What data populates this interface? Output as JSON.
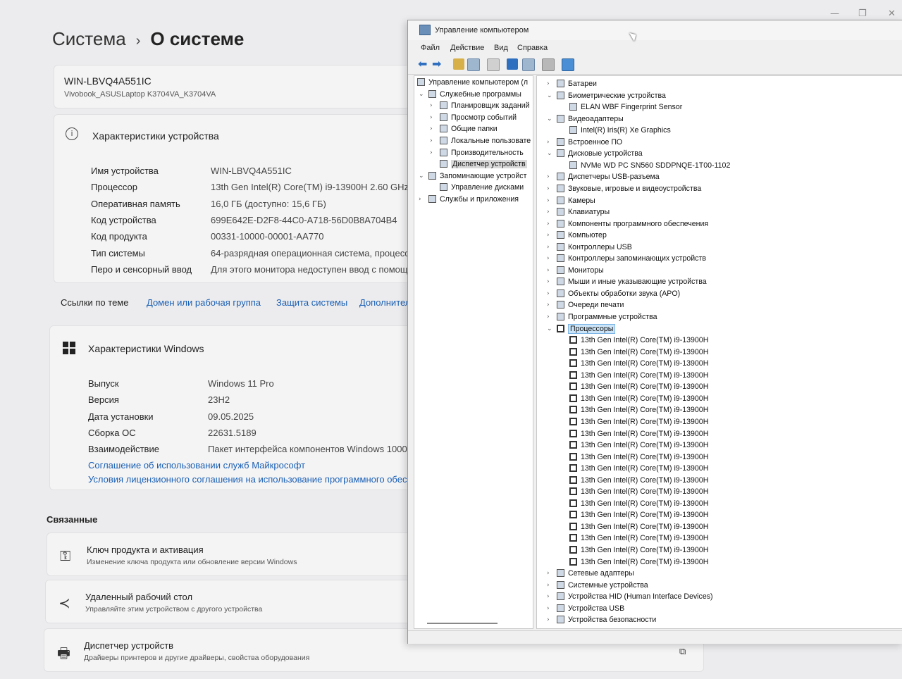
{
  "settings": {
    "breadcrumb": {
      "root": "Система",
      "separator": "›",
      "current": "О системе"
    },
    "device_card": {
      "name": "WIN-LBVQ4A551IC",
      "model": "Vivobook_ASUSLaptop K3704VA_K3704VA"
    },
    "device_specs": {
      "heading": "Характеристики устройства",
      "rows": [
        {
          "key": "Имя устройства",
          "value": "WIN-LBVQ4A551IC"
        },
        {
          "key": "Процессор",
          "value": "13th Gen Intel(R) Core(TM) i9-13900H   2.60 GHz"
        },
        {
          "key": "Оперативная память",
          "value": "16,0 ГБ (доступно: 15,6 ГБ)"
        },
        {
          "key": "Код устройства",
          "value": "699E642E-D2F8-44C0-A718-56D0B8A704B4"
        },
        {
          "key": "Код продукта",
          "value": "00331-10000-00001-AA770"
        },
        {
          "key": "Тип системы",
          "value": "64-разрядная операционная система, процессо"
        },
        {
          "key": "Перо и сенсорный ввод",
          "value": "Для этого монитора недоступен ввод с помощь"
        }
      ]
    },
    "related_links": {
      "label": "Ссылки по теме",
      "links": [
        "Домен или рабочая группа",
        "Защита системы",
        "Дополнител"
      ]
    },
    "windows_specs": {
      "heading": "Характеристики Windows",
      "rows": [
        {
          "key": "Выпуск",
          "value": "Windows 11 Pro"
        },
        {
          "key": "Версия",
          "value": "23H2"
        },
        {
          "key": "Дата установки",
          "value": "09.05.2025"
        },
        {
          "key": "Сборка ОС",
          "value": "22631.5189"
        },
        {
          "key": "Взаимодействие",
          "value": "Пакет интерфейса компонентов Windows 1000.2"
        }
      ],
      "links": [
        "Соглашение об использовании служб Майкрософт",
        "Условия лицензионного соглашения на использование программного обес"
      ]
    },
    "related": {
      "heading": "Связанные",
      "items": [
        {
          "icon": "key-icon",
          "title": "Ключ продукта и активация",
          "subtitle": "Изменение ключа продукта или обновление версии Windows"
        },
        {
          "icon": "remote-desktop-icon",
          "title": "Удаленный рабочий стол",
          "subtitle": "Управляйте этим устройством с другого устройства"
        },
        {
          "icon": "device-manager-icon",
          "title": "Диспетчер устройств",
          "subtitle": "Драйверы принтеров и другие драйверы, свойства оборудования"
        }
      ]
    },
    "window_controls": {
      "minimize": "—",
      "maximize": "❐",
      "close": "✕"
    }
  },
  "mmc": {
    "title": "Управление компьютером",
    "menu": [
      "Файл",
      "Действие",
      "Вид",
      "Справка"
    ],
    "left_tree": [
      {
        "label": "Управление компьютером (л",
        "level": 0,
        "chev": ""
      },
      {
        "label": "Служебные программы",
        "level": 1,
        "chev": "v"
      },
      {
        "label": "Планировщик заданий",
        "level": 2,
        "chev": ">"
      },
      {
        "label": "Просмотр событий",
        "level": 2,
        "chev": ">"
      },
      {
        "label": "Общие папки",
        "level": 2,
        "chev": ">"
      },
      {
        "label": "Локальные пользовате",
        "level": 2,
        "chev": ">"
      },
      {
        "label": "Производительность",
        "level": 2,
        "chev": ">"
      },
      {
        "label": "Диспетчер устройств",
        "level": 2,
        "chev": "",
        "selected": true
      },
      {
        "label": "Запоминающие устройст",
        "level": 1,
        "chev": "v"
      },
      {
        "label": "Управление дисками",
        "level": 2,
        "chev": ""
      },
      {
        "label": "Службы и приложения",
        "level": 1,
        "chev": ">"
      }
    ],
    "right_tree": [
      {
        "label": "Батареи",
        "level": 0,
        "chev": ">"
      },
      {
        "label": "Биометрические устройства",
        "level": 0,
        "chev": "v"
      },
      {
        "label": "ELAN WBF Fingerprint Sensor",
        "level": 1,
        "chev": ""
      },
      {
        "label": "Видеоадаптеры",
        "level": 0,
        "chev": "v"
      },
      {
        "label": "Intel(R) Iris(R) Xe Graphics",
        "level": 1,
        "chev": ""
      },
      {
        "label": "Встроенное ПО",
        "level": 0,
        "chev": ">"
      },
      {
        "label": "Дисковые устройства",
        "level": 0,
        "chev": "v"
      },
      {
        "label": "NVMe WD PC SN560 SDDPNQE-1T00-1102",
        "level": 1,
        "chev": ""
      },
      {
        "label": "Диспетчеры USB-разъема",
        "level": 0,
        "chev": ">"
      },
      {
        "label": "Звуковые, игровые и видеоустройства",
        "level": 0,
        "chev": ">"
      },
      {
        "label": "Камеры",
        "level": 0,
        "chev": ">"
      },
      {
        "label": "Клавиатуры",
        "level": 0,
        "chev": ">"
      },
      {
        "label": "Компоненты программного обеспечения",
        "level": 0,
        "chev": ">"
      },
      {
        "label": "Компьютер",
        "level": 0,
        "chev": ">"
      },
      {
        "label": "Контроллеры USB",
        "level": 0,
        "chev": ">"
      },
      {
        "label": "Контроллеры запоминающих устройств",
        "level": 0,
        "chev": ">"
      },
      {
        "label": "Мониторы",
        "level": 0,
        "chev": ">"
      },
      {
        "label": "Мыши и иные указывающие устройства",
        "level": 0,
        "chev": ">"
      },
      {
        "label": "Объекты обработки звука (APO)",
        "level": 0,
        "chev": ">"
      },
      {
        "label": "Очереди печати",
        "level": 0,
        "chev": ">"
      },
      {
        "label": "Программные устройства",
        "level": 0,
        "chev": ">"
      },
      {
        "label": "Процессоры",
        "level": 0,
        "chev": "v",
        "selected": true,
        "cpu": true
      },
      {
        "label": "13th Gen Intel(R) Core(TM) i9-13900H",
        "level": 1,
        "chev": "",
        "cpu": true
      },
      {
        "label": "13th Gen Intel(R) Core(TM) i9-13900H",
        "level": 1,
        "chev": "",
        "cpu": true
      },
      {
        "label": "13th Gen Intel(R) Core(TM) i9-13900H",
        "level": 1,
        "chev": "",
        "cpu": true
      },
      {
        "label": "13th Gen Intel(R) Core(TM) i9-13900H",
        "level": 1,
        "chev": "",
        "cpu": true
      },
      {
        "label": "13th Gen Intel(R) Core(TM) i9-13900H",
        "level": 1,
        "chev": "",
        "cpu": true
      },
      {
        "label": "13th Gen Intel(R) Core(TM) i9-13900H",
        "level": 1,
        "chev": "",
        "cpu": true
      },
      {
        "label": "13th Gen Intel(R) Core(TM) i9-13900H",
        "level": 1,
        "chev": "",
        "cpu": true
      },
      {
        "label": "13th Gen Intel(R) Core(TM) i9-13900H",
        "level": 1,
        "chev": "",
        "cpu": true
      },
      {
        "label": "13th Gen Intel(R) Core(TM) i9-13900H",
        "level": 1,
        "chev": "",
        "cpu": true
      },
      {
        "label": "13th Gen Intel(R) Core(TM) i9-13900H",
        "level": 1,
        "chev": "",
        "cpu": true
      },
      {
        "label": "13th Gen Intel(R) Core(TM) i9-13900H",
        "level": 1,
        "chev": "",
        "cpu": true
      },
      {
        "label": "13th Gen Intel(R) Core(TM) i9-13900H",
        "level": 1,
        "chev": "",
        "cpu": true
      },
      {
        "label": "13th Gen Intel(R) Core(TM) i9-13900H",
        "level": 1,
        "chev": "",
        "cpu": true
      },
      {
        "label": "13th Gen Intel(R) Core(TM) i9-13900H",
        "level": 1,
        "chev": "",
        "cpu": true
      },
      {
        "label": "13th Gen Intel(R) Core(TM) i9-13900H",
        "level": 1,
        "chev": "",
        "cpu": true
      },
      {
        "label": "13th Gen Intel(R) Core(TM) i9-13900H",
        "level": 1,
        "chev": "",
        "cpu": true
      },
      {
        "label": "13th Gen Intel(R) Core(TM) i9-13900H",
        "level": 1,
        "chev": "",
        "cpu": true
      },
      {
        "label": "13th Gen Intel(R) Core(TM) i9-13900H",
        "level": 1,
        "chev": "",
        "cpu": true
      },
      {
        "label": "13th Gen Intel(R) Core(TM) i9-13900H",
        "level": 1,
        "chev": "",
        "cpu": true
      },
      {
        "label": "13th Gen Intel(R) Core(TM) i9-13900H",
        "level": 1,
        "chev": "",
        "cpu": true
      },
      {
        "label": "Сетевые адаптеры",
        "level": 0,
        "chev": ">"
      },
      {
        "label": "Системные устройства",
        "level": 0,
        "chev": ">"
      },
      {
        "label": "Устройства HID (Human Interface Devices)",
        "level": 0,
        "chev": ">"
      },
      {
        "label": "Устройства USB",
        "level": 0,
        "chev": ">"
      },
      {
        "label": "Устройства безопасности",
        "level": 0,
        "chev": ">"
      }
    ],
    "colors": {
      "accent": "#2f6fc0",
      "selection": "#cce4f7",
      "link": "#1a5fb4"
    }
  }
}
